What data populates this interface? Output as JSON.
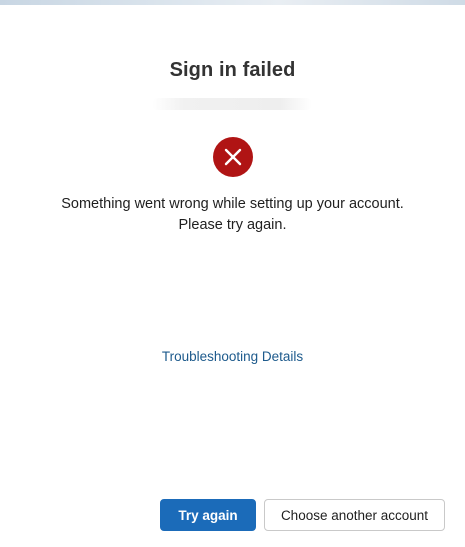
{
  "dialog": {
    "title": "Sign in failed",
    "message": "Something went wrong while setting up your account. Please try again.",
    "troubleshooting_link": "Troubleshooting Details",
    "icon": "error-x-icon"
  },
  "buttons": {
    "primary_label": "Try again",
    "secondary_label": "Choose another account"
  },
  "colors": {
    "error": "#b01414",
    "primary": "#1b6bb9",
    "link": "#1d5a8c"
  }
}
